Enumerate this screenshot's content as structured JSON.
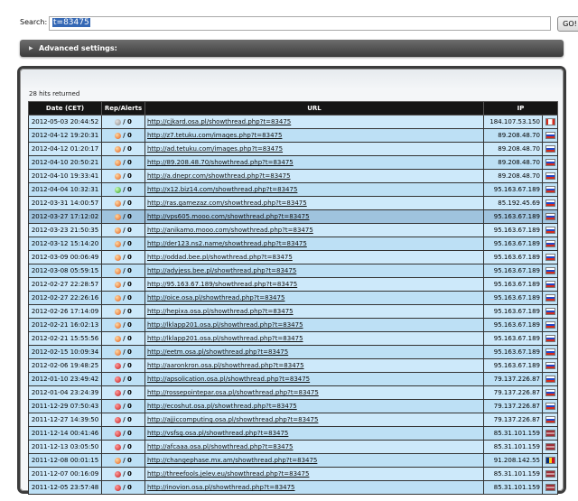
{
  "search": {
    "label": "Search:",
    "value": "t=83475",
    "button": "GO!"
  },
  "advanced": {
    "label": "Advanced settings:"
  },
  "results": {
    "count_text": "28 hits returned",
    "headers": {
      "date": "Date (CET)",
      "rep": "Rep/Alerts",
      "url": "URL",
      "ip": "IP"
    },
    "rows": [
      {
        "date": "2012-05-03 20:44:52",
        "rep_color": "grey",
        "alerts": "/ 0",
        "url": "http://cjkard.osa.pl/showthread.php?t=83475",
        "ip": "184.107.53.150",
        "flag": "ca"
      },
      {
        "date": "2012-04-12 19:20:31",
        "rep_color": "orange",
        "alerts": "/ 0",
        "url": "http://z7.tetuku.com/images.php?t=83475",
        "ip": "89.208.48.70",
        "flag": "ru"
      },
      {
        "date": "2012-04-12 01:20:17",
        "rep_color": "orange",
        "alerts": "/ 0",
        "url": "http://ad.tetuku.com/images.php?t=83475",
        "ip": "89.208.48.70",
        "flag": "ru"
      },
      {
        "date": "2012-04-10 20:50:21",
        "rep_color": "orange",
        "alerts": "/ 0",
        "url": "http://89.208.48.70/showthread.php?t=83475",
        "ip": "89.208.48.70",
        "flag": "ru"
      },
      {
        "date": "2012-04-10 19:33:41",
        "rep_color": "orange",
        "alerts": "/ 0",
        "url": "http://a.dnepr.com/showthread.php?t=83475",
        "ip": "89.208.48.70",
        "flag": "ru"
      },
      {
        "date": "2012-04-04 10:32:31",
        "rep_color": "green",
        "alerts": "/ 0",
        "url": "http://x12.biz14.com/showthread.php?t=83475",
        "ip": "95.163.67.189",
        "flag": "ru"
      },
      {
        "date": "2012-03-31 14:00:57",
        "rep_color": "orange",
        "alerts": "/ 0",
        "url": "http://ras.gamezaz.com/showthread.php?t=83475",
        "ip": "85.192.45.69",
        "flag": "ru"
      },
      {
        "date": "2012-03-27 17:12:02",
        "rep_color": "orange",
        "alerts": "/ 0",
        "url": "http://vps605.mooo.com/showthread.php?t=83475",
        "ip": "95.163.67.189",
        "flag": "ru"
      },
      {
        "date": "2012-03-23 21:50:35",
        "rep_color": "orange",
        "alerts": "/ 0",
        "url": "http://anikamo.mooo.com/showthread.php?t=83475",
        "ip": "95.163.67.189",
        "flag": "ru"
      },
      {
        "date": "2012-03-12 15:14:20",
        "rep_color": "orange",
        "alerts": "/ 0",
        "url": "http://der123.ns2.name/showthread.php?t=83475",
        "ip": "95.163.67.189",
        "flag": "ru"
      },
      {
        "date": "2012-03-09 00:06:49",
        "rep_color": "orange",
        "alerts": "/ 0",
        "url": "http://oddad.bee.pl/showthread.php?t=83475",
        "ip": "95.163.67.189",
        "flag": "ru"
      },
      {
        "date": "2012-03-08 05:59:15",
        "rep_color": "orange",
        "alerts": "/ 0",
        "url": "http://adyjess.bee.pl/showthread.php?t=83475",
        "ip": "95.163.67.189",
        "flag": "ru"
      },
      {
        "date": "2012-02-27 22:28:57",
        "rep_color": "orange",
        "alerts": "/ 0",
        "url": "http://95.163.67.189/showthread.php?t=83475",
        "ip": "95.163.67.189",
        "flag": "ru"
      },
      {
        "date": "2012-02-27 22:26:16",
        "rep_color": "orange",
        "alerts": "/ 0",
        "url": "http://oice.osa.pl/showthread.php?t=83475",
        "ip": "95.163.67.189",
        "flag": "ru"
      },
      {
        "date": "2012-02-26 17:14:09",
        "rep_color": "orange",
        "alerts": "/ 0",
        "url": "http://hepixa.osa.pl/showthread.php?t=83475",
        "ip": "95.163.67.189",
        "flag": "ru"
      },
      {
        "date": "2012-02-21 16:02:13",
        "rep_color": "orange",
        "alerts": "/ 0",
        "url": "http://lklapp201.osa.pl/showthread.php?t=83475",
        "ip": "95.163.67.189",
        "flag": "ru"
      },
      {
        "date": "2012-02-21 15:55:56",
        "rep_color": "orange",
        "alerts": "/ 0",
        "url": "http://lklapp201.osa.pl/showthread.php?t=83475",
        "ip": "95.163.67.189",
        "flag": "ru"
      },
      {
        "date": "2012-02-15 10:09:34",
        "rep_color": "orange",
        "alerts": "/ 0",
        "url": "http://eetm.osa.pl/showthread.php?t=83475",
        "ip": "95.163.67.189",
        "flag": "ru"
      },
      {
        "date": "2012-02-06 19:48:25",
        "rep_color": "red",
        "alerts": "/ 0",
        "url": "http://aaronkron.osa.pl/showthread.php?t=83475",
        "ip": "95.163.67.189",
        "flag": "ru"
      },
      {
        "date": "2012-01-10 23:49:42",
        "rep_color": "red",
        "alerts": "/ 0",
        "url": "http://apsolication.osa.pl/showthread.php?t=83475",
        "ip": "79.137.226.87",
        "flag": "ru"
      },
      {
        "date": "2012-01-04 23:24:39",
        "rep_color": "red",
        "alerts": "/ 0",
        "url": "http://rossepointepar.osa.pl/showthread.php?t=83475",
        "ip": "79.137.226.87",
        "flag": "ru"
      },
      {
        "date": "2011-12-29 07:50:43",
        "rep_color": "red",
        "alerts": "/ 0",
        "url": "http://ecoshut.osa.pl/showthread.php?t=83475",
        "ip": "79.137.226.87",
        "flag": "ru"
      },
      {
        "date": "2011-12-27 14:39:50",
        "rep_color": "red",
        "alerts": "/ 0",
        "url": "http://ajjiccomputing.osa.pl/showthread.php?t=83475",
        "ip": "79.137.226.87",
        "flag": "ru"
      },
      {
        "date": "2011-12-14 00:41:46",
        "rep_color": "red",
        "alerts": "/ 0",
        "url": "http://vsfsg.osa.pl/showthread.php?t=83475",
        "ip": "85.31.101.159",
        "flag": "lv"
      },
      {
        "date": "2011-12-13 03:05:50",
        "rep_color": "red",
        "alerts": "/ 0",
        "url": "http://afcaaa.osa.pl/showthread.php?t=83475",
        "ip": "85.31.101.159",
        "flag": "lv"
      },
      {
        "date": "2011-12-08 00:01:15",
        "rep_color": "orange",
        "alerts": "/ 0",
        "url": "http://changephase.mx.am/showthread.php?t=83475",
        "ip": "91.208.142.55",
        "flag": "ro"
      },
      {
        "date": "2011-12-07 00:16:09",
        "rep_color": "red",
        "alerts": "/ 0",
        "url": "http://threefools.jelev.eu/showthread.php?t=83475",
        "ip": "85.31.101.159",
        "flag": "lv"
      },
      {
        "date": "2011-12-05 23:57:48",
        "rep_color": "red",
        "alerts": "/ 0",
        "url": "http://inovion.osa.pl/showthread.php?t=83475",
        "ip": "85.31.101.159",
        "flag": "lv"
      }
    ]
  }
}
